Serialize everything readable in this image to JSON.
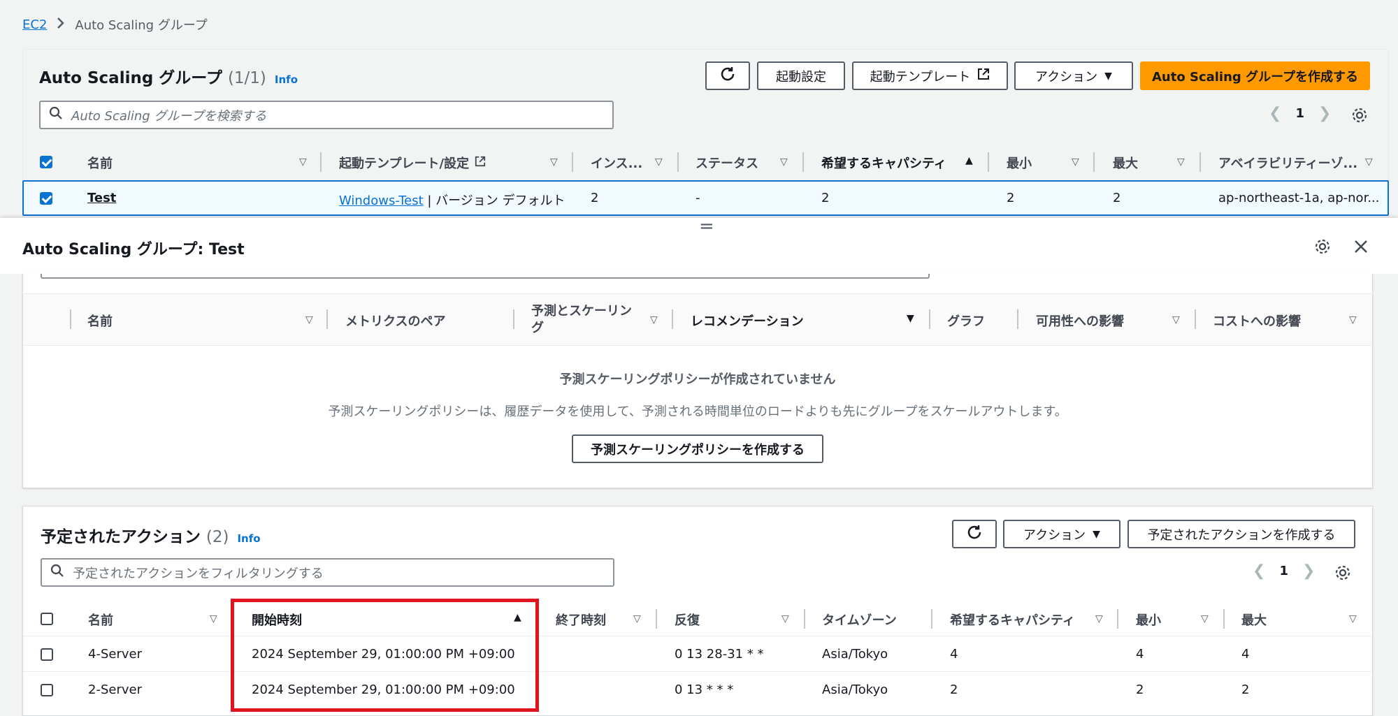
{
  "breadcrumb": {
    "root": "EC2",
    "current": "Auto Scaling グループ"
  },
  "asg_list": {
    "title": "Auto Scaling グループ",
    "count": "(1/1)",
    "info": "Info",
    "buttons": {
      "launch_config": "起動設定",
      "launch_template": "起動テンプレート",
      "actions": "アクション",
      "create": "Auto Scaling グループを作成する"
    },
    "search_placeholder": "Auto Scaling グループを検索する",
    "page": "1",
    "columns": [
      "名前",
      "起動テンプレート/設定",
      "インス...",
      "ステータス",
      "希望するキャパシティ",
      "最小",
      "最大",
      "アベイラビリティーゾ..."
    ],
    "row": {
      "name": "Test",
      "template_link": "Windows-Test",
      "template_rest": "| バージョン デフォルト",
      "instances": "2",
      "status": "-",
      "desired": "2",
      "min": "2",
      "max": "2",
      "az": "ap-northeast-1a, ap-nor..."
    }
  },
  "detail": {
    "title": "Auto Scaling グループ: Test",
    "resize_handle": "="
  },
  "predictive": {
    "columns": [
      "名前",
      "メトリクスのペア",
      "予測とスケーリング",
      "レコメンデーション",
      "グラフ",
      "可用性への影響",
      "コストへの影響"
    ],
    "empty_title": "予測スケーリングポリシーが作成されていません",
    "empty_desc": "予測スケーリングポリシーは、履歴データを使用して、予測される時間単位のロードよりも先にグループをスケールアウトします。",
    "create_button": "予測スケーリングポリシーを作成する"
  },
  "scheduled": {
    "title": "予定されたアクション",
    "count": "(2)",
    "info": "Info",
    "actions_button": "アクション",
    "create_button": "予定されたアクションを作成する",
    "search_placeholder": "予定されたアクションをフィルタリングする",
    "page": "1",
    "columns": [
      "名前",
      "開始時刻",
      "終了時刻",
      "反復",
      "タイムゾーン",
      "希望するキャパシティ",
      "最小",
      "最大"
    ],
    "rows": [
      {
        "name": "4-Server",
        "start": "2024 September 29, 01:00:00 PM +09:00",
        "end": "",
        "recurrence": "0 13 28-31 * *",
        "tz": "Asia/Tokyo",
        "desired": "4",
        "min": "4",
        "max": "4"
      },
      {
        "name": "2-Server",
        "start": "2024 September 29, 01:00:00 PM +09:00",
        "end": "",
        "recurrence": "0 13 * * *",
        "tz": "Asia/Tokyo",
        "desired": "2",
        "min": "2",
        "max": "2"
      }
    ]
  },
  "colors": {
    "primary": "#ff9900",
    "link": "#0972d3",
    "highlight_box": "#e0141e",
    "selected_row": "#f1faff"
  }
}
